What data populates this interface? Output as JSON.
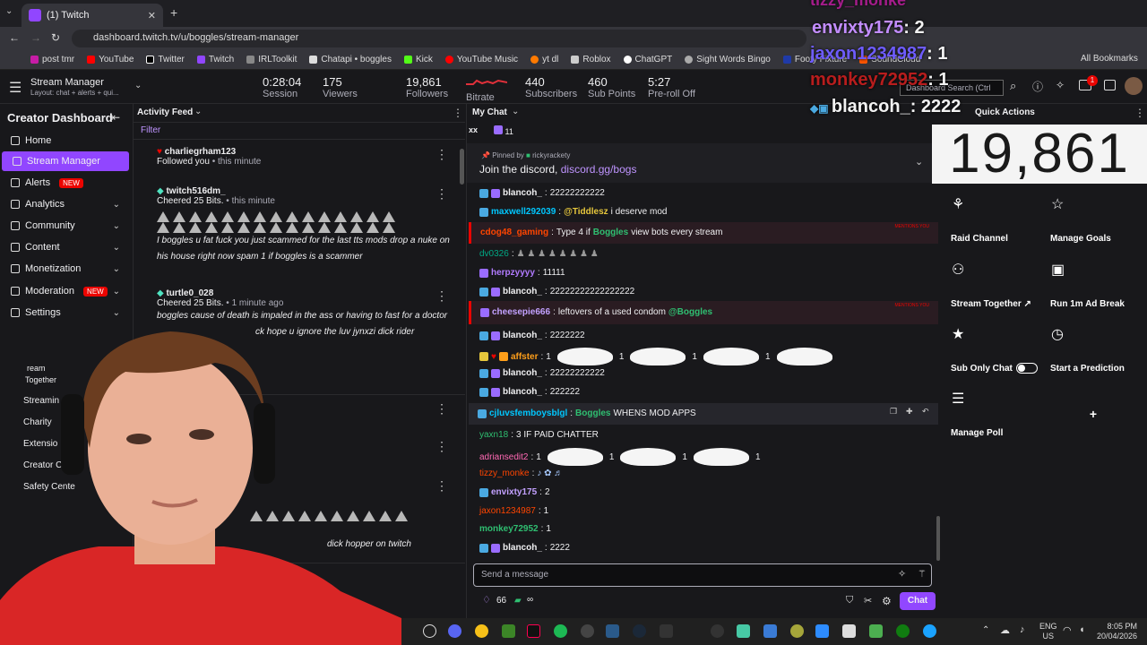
{
  "browser": {
    "tab_title": "(1) Twitch",
    "url": "dashboard.twitch.tv/u/boggles/stream-manager",
    "bookmarks": [
      "post tmr",
      "YouTube",
      "Twitter",
      "Twitch",
      "IRLToolkit",
      "Chatapi • boggles",
      "Kick",
      "YouTube Music",
      "yt dl",
      "Roblox",
      "ChatGPT",
      "Sight Words Bingo",
      "Footy Fixture",
      "SoundCloud"
    ],
    "all_bookmarks": "All Bookmarks"
  },
  "header": {
    "title": "Stream Manager",
    "subtitle": "Layout: chat + alerts + qui...",
    "stats": [
      {
        "value": "0:28:04",
        "label": "Session"
      },
      {
        "value": "175",
        "label": "Viewers"
      },
      {
        "value": "19,861",
        "label": "Followers"
      },
      {
        "value": "",
        "label": "Bitrate"
      },
      {
        "value": "440",
        "label": "Subscribers"
      },
      {
        "value": "460",
        "label": "Sub Points"
      },
      {
        "value": "5:27",
        "label": "Pre-roll Off"
      }
    ],
    "search_placeholder": "Dashboard Search (Ctrl",
    "notif_count": "1"
  },
  "sidebar": {
    "title": "Creator Dashboard",
    "items": [
      "Home",
      "Stream Manager",
      "Alerts",
      "Analytics",
      "Community",
      "Content",
      "Monetization",
      "Moderation",
      "Settings"
    ],
    "new_badge": "NEW",
    "lower_items": [
      "Stream Together",
      "Streaming",
      "Charity",
      "Extensions",
      "Creator Camp",
      "Safety Center"
    ],
    "lower_items_visible": [
      "ream",
      "Together",
      "Streamin",
      "Charity",
      "Extensio",
      "Creator C",
      "Safety Cente"
    ]
  },
  "feed": {
    "title": "Activity Feed",
    "filter": "Filter",
    "items": [
      {
        "user": "charliegrham123",
        "action": "Followed you",
        "time": "this minute",
        "message": ""
      },
      {
        "user": "twitch516dm_",
        "action": "Cheered 25 Bits.",
        "time": "this minute",
        "message": "I boggles u fat fuck you just scammed for the last tts mods drop a nuke on his house right now spam 1 if boggles is a scammer"
      },
      {
        "user": "turtle0_028",
        "action": "Cheered 25 Bits.",
        "time": "1 minute ago",
        "message": "boggles cause of death is impaled in the ass or having to fast for a doctor"
      },
      {
        "user": "",
        "action": "",
        "time": "",
        "message": "ck hope u ignore the luv jynxzi dick rider"
      },
      {
        "user": "",
        "action": "",
        "time": "",
        "message": "dick hopper on twitch"
      }
    ]
  },
  "chat": {
    "title": "My Chat",
    "header_left": "xx",
    "header_count": "11",
    "pinned_by": "Pinned by",
    "pinned_user": "rickyrackety",
    "pinned_text": "Join the discord,",
    "pinned_link": "discord.gg/bogs",
    "mentions_you": "MENTIONS YOU",
    "messages": [
      {
        "user": "blancoh_",
        "text": "22222222222",
        "color": "#efeff1"
      },
      {
        "user": "maxwell292039",
        "text": "i deserve mod",
        "color": "#00c7ff",
        "mention": "@Tiddlesz"
      },
      {
        "user": "cdog48_gaming",
        "text": "Type 4 if",
        "text2": "view bots every stream",
        "color": "#ff4500",
        "mention": "Boggles"
      },
      {
        "user": "dv0326",
        "text": "",
        "color": "#00a884"
      },
      {
        "user": "herpzyyyy",
        "text": "11111",
        "color": "#b27bff"
      },
      {
        "user": "blancoh_",
        "text": "22222222222222222",
        "color": "#efeff1"
      },
      {
        "user": "cheesepie666",
        "text": "leftovers of a used condom",
        "color": "#c3a1ff",
        "mention": "@Boggles"
      },
      {
        "user": "blancoh_",
        "text": "2222222",
        "color": "#efeff1"
      },
      {
        "user": "affster",
        "text": "1",
        "color": "#ff9f1a"
      },
      {
        "user": "blancoh_",
        "text": "22222222222",
        "color": "#efeff1"
      },
      {
        "user": "blancoh_",
        "text": "222222",
        "color": "#efeff1"
      },
      {
        "user": "cjluvsfemboysblgl",
        "text": "WHENS MOD APPS",
        "color": "#00c7ff",
        "mention": "Boggles"
      },
      {
        "user": "yaxn18",
        "text": "3 IF PAID CHATTER",
        "color": "#2fbf71"
      },
      {
        "user": "adriansedit2",
        "text": "1",
        "color": "#ff69b4"
      },
      {
        "user": "tizzy_monke",
        "text": "",
        "color": "#ff4500"
      },
      {
        "user": "envixty175",
        "text": "2",
        "color": "#c3a1ff"
      },
      {
        "user": "jaxon1234987",
        "text": "1",
        "color": "#ff4500"
      },
      {
        "user": "monkey72952",
        "text": "1",
        "color": "#2fbf71"
      },
      {
        "user": "blancoh_",
        "text": "2222",
        "color": "#efeff1"
      }
    ],
    "input_placeholder": "Send a message",
    "points": "66",
    "infinity": "∞",
    "send_label": "Chat"
  },
  "quick_actions": {
    "title": "Quick Actions",
    "follower_count_display": "19,861",
    "tiles": [
      {
        "label": "Raid Channel",
        "color": "#c71ca6"
      },
      {
        "label": "Manage Goals",
        "color": "#c71ca6"
      },
      {
        "label": "Stream Together",
        "color": "#c71ca6"
      },
      {
        "label": "Run 1m Ad Break",
        "color": "#1f9b63"
      },
      {
        "label": "Sub Only Chat",
        "color": "#1f69ff"
      },
      {
        "label": "Start a Prediction",
        "color": "#c71ca6"
      },
      {
        "label": "Manage Poll",
        "color": "#c71ca6"
      },
      {
        "label": "+",
        "color": "#2a2a2e"
      }
    ]
  },
  "overlay": {
    "lines": [
      {
        "user": "envixty175",
        "value": "2",
        "color": "#c38dff"
      },
      {
        "user": "jaxon1234987",
        "value": "1",
        "color": "#6e5cff"
      },
      {
        "user": "monkey72952",
        "value": "1",
        "color": "#b81d1d"
      },
      {
        "user": "blancoh_",
        "value": "2222",
        "color": "#f2f2f2"
      }
    ],
    "top_partial": "tizzy_monke"
  },
  "taskbar": {
    "lang": "ENG",
    "region": "US",
    "time": "8:05 PM",
    "date": "20/04/2026"
  }
}
